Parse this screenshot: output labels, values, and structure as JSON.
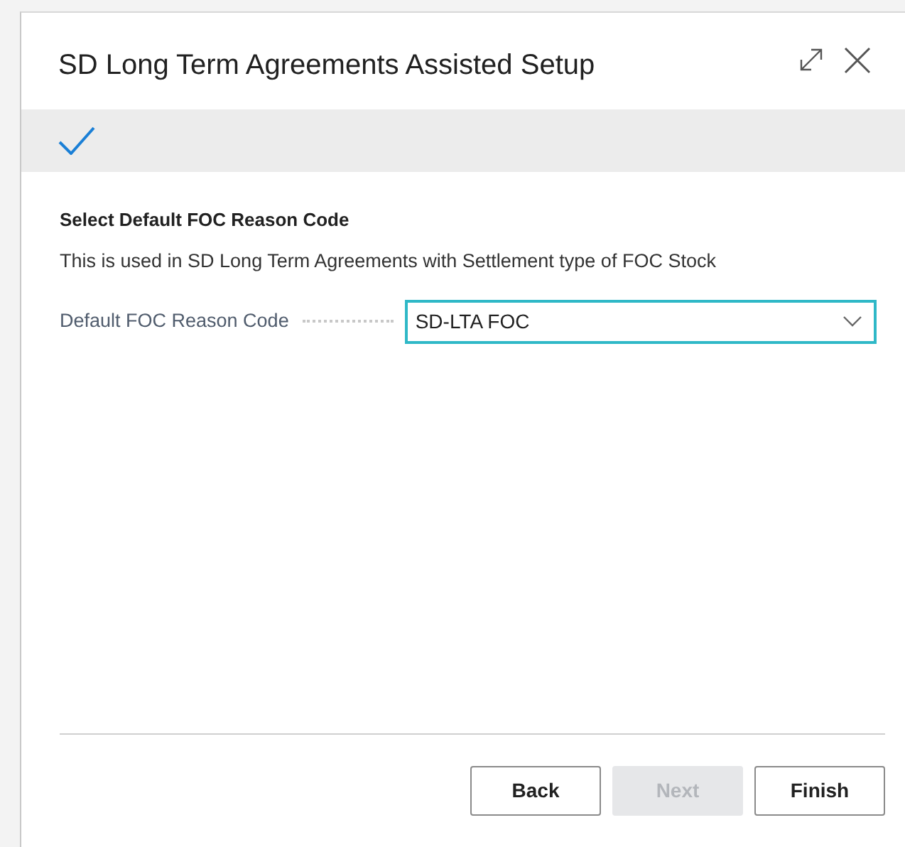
{
  "dialog": {
    "title": "SD Long Term Agreements Assisted Setup"
  },
  "step": {
    "completed": true
  },
  "section": {
    "heading": "Select Default FOC Reason Code",
    "description": "This is used in SD Long Term Agreements with Settlement type of FOC Stock"
  },
  "fields": [
    {
      "label": "Default FOC Reason Code",
      "value": "SD-LTA FOC",
      "focused": true
    }
  ],
  "buttons": [
    {
      "label": "Back",
      "disabled": false
    },
    {
      "label": "Next",
      "disabled": true
    },
    {
      "label": "Finish",
      "disabled": false
    }
  ]
}
